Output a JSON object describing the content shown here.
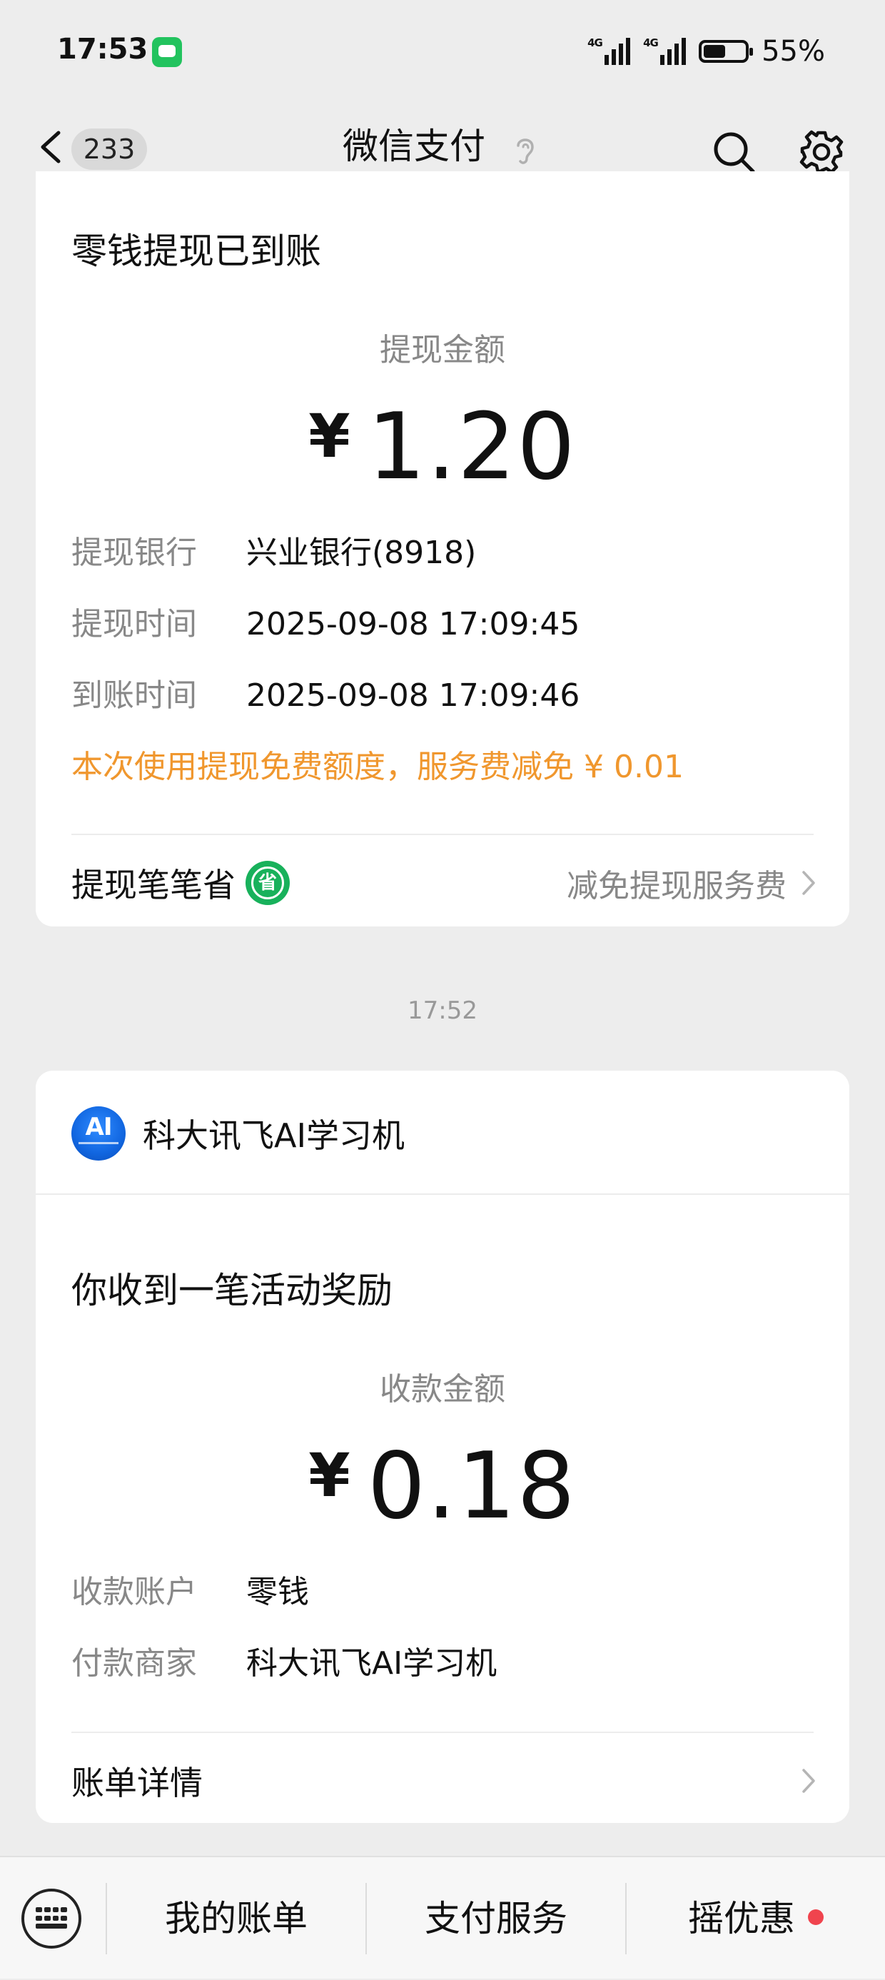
{
  "status_bar": {
    "time": "17:53",
    "battery_percent": "55%",
    "network_1": "4G",
    "network_2": "4G",
    "app_icon": "messages-icon"
  },
  "nav": {
    "unread_count": "233",
    "title": "微信支付",
    "icons": [
      "back-arrow-icon",
      "ear-icon",
      "search-icon",
      "gear-icon"
    ]
  },
  "withdraw_card": {
    "title": "零钱提现已到账",
    "amount_label": "提现金额",
    "currency": "¥",
    "amount": "1.20",
    "rows": [
      {
        "key": "提现银行",
        "value": "兴业银行(8918)"
      },
      {
        "key": "提现时间",
        "value": "2025-09-08 17:09:45"
      },
      {
        "key": "到账时间",
        "value": "2025-09-08 17:09:46"
      }
    ],
    "note": "本次使用提现免费额度，服务费减免 ¥ 0.01",
    "link_left": "提现笔笔省",
    "link_badge": "省",
    "link_right": "减免提现服务费"
  },
  "time_separator": "17:52",
  "reward_card": {
    "merchant_logo_text": "AI",
    "merchant_name": "科大讯飞AI学习机",
    "title": "你收到一笔活动奖励",
    "amount_label": "收款金额",
    "currency": "¥",
    "amount": "0.18",
    "rows": [
      {
        "key": "收款账户",
        "value": "零钱"
      },
      {
        "key": "付款商家",
        "value": "科大讯飞AI学习机"
      }
    ],
    "link_left": "账单详情"
  },
  "bottom_bar": {
    "tabs": [
      "我的账单",
      "支付服务",
      "摇优惠"
    ],
    "accent_dot_color": "#f0444e"
  },
  "colors": {
    "note_orange": "#f0972e",
    "save_badge_green": "#18b15b",
    "background": "#ededed"
  }
}
